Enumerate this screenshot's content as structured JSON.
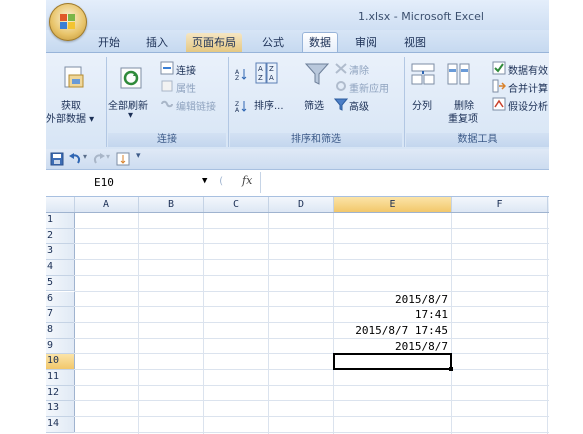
{
  "window": {
    "title": "1.xlsx - Microsoft Excel"
  },
  "tabs": [
    {
      "label": "开始"
    },
    {
      "label": "插入"
    },
    {
      "label": "页面布局"
    },
    {
      "label": "公式"
    },
    {
      "label": "数据"
    },
    {
      "label": "审阅"
    },
    {
      "label": "视图"
    }
  ],
  "ribbon": {
    "get_external": {
      "line1": "获取",
      "line2": "外部数据 ▾"
    },
    "refresh_all": {
      "line1": "全部刷新",
      "line2": "▾"
    },
    "connections": {
      "label": "连接",
      "properties": "属性",
      "edit_links": "编辑链接",
      "group": "连接"
    },
    "sort": {
      "label": "排序...",
      "filter": "筛选",
      "clear": "清除",
      "reapply": "重新应用",
      "advanced": "高级",
      "group": "排序和筛选"
    },
    "data_tools": {
      "split": "分列",
      "remove_dup_1": "删除",
      "remove_dup_2": "重复项",
      "validation": "数据有效",
      "consolidate": "合并计算",
      "whatif": "假设分析",
      "group": "数据工具"
    }
  },
  "formula_bar": {
    "name_box": "E10",
    "fx": "fx",
    "value": ""
  },
  "columns": [
    "A",
    "B",
    "C",
    "D",
    "E",
    "F"
  ],
  "rows": [
    "1",
    "2",
    "3",
    "4",
    "5",
    "6",
    "7",
    "8",
    "9",
    "10",
    "11",
    "12",
    "13",
    "14"
  ],
  "selected": {
    "column": "E",
    "row": "10"
  },
  "cells": {
    "E6": "2015/8/7",
    "E7": "17:41",
    "E8": "2015/8/7 17:45",
    "E9": "2015/8/7"
  },
  "colors": {
    "accent": "#f2c76b",
    "ribbon": "#d7e5f5"
  }
}
